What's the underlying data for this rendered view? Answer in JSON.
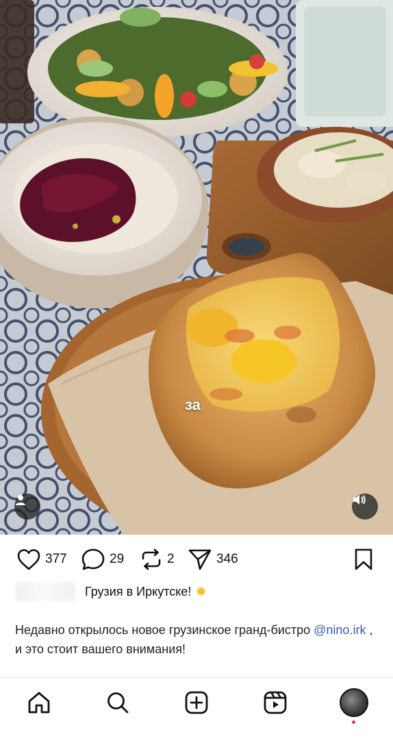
{
  "media": {
    "overlay_caption": "за"
  },
  "actions": {
    "likes": "377",
    "comments": "29",
    "reposts": "2",
    "shares": "346"
  },
  "caption": {
    "title": "Грузия в Иркутске!",
    "body_text": "Недавно открылось новое грузинское гранд-бистро ",
    "mention": "@nino.irk",
    "body_suffix": " , и это стоит вашего внимания!"
  },
  "icons": {
    "like": "heart-icon",
    "comment": "comment-icon",
    "repost": "repost-icon",
    "share": "send-icon",
    "save": "bookmark-icon",
    "home": "home-icon",
    "search": "search-icon",
    "create": "create-icon",
    "reels": "reels-icon",
    "user": "user-icon",
    "sound": "sound-icon"
  },
  "colors": {
    "mention": "#3b5bb5",
    "sun_emoji": "#f4c22b",
    "notification_dot": "#ff2d55"
  }
}
